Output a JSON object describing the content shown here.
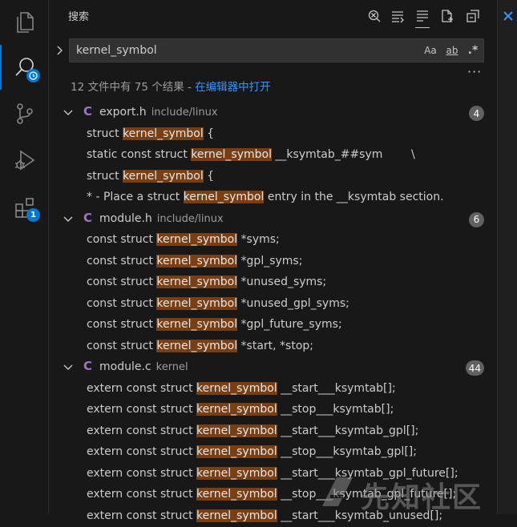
{
  "activity_bar": {
    "items": [
      {
        "name": "explorer"
      },
      {
        "name": "search",
        "active": true
      },
      {
        "name": "source-control"
      },
      {
        "name": "run-debug"
      },
      {
        "name": "extensions",
        "badge": "1"
      }
    ]
  },
  "sidebar": {
    "title": "搜索",
    "header_icons": [
      "clear-results-icon",
      "replace-all-icon",
      "collapse-view-icon",
      "new-search-editor-icon",
      "collapse-all-icon"
    ],
    "search": {
      "value": "kernel_symbol",
      "options": {
        "match_case": "Aa",
        "whole_word": "ab",
        "regex": ".*"
      }
    },
    "more": "···",
    "summary": {
      "text": "12 文件中有 75 个结果 - ",
      "link": "在编辑器中打开"
    },
    "files": [
      {
        "name": "export.h",
        "path": "include/linux",
        "count": "4",
        "matches": [
          {
            "pre": "struct ",
            "hl": "kernel_symbol",
            "post": " {"
          },
          {
            "pre": "static const struct ",
            "hl": "kernel_symbol",
            "post": " __ksymtab_##sym        \\"
          },
          {
            "pre": "struct ",
            "hl": "kernel_symbol",
            "post": " {"
          },
          {
            "pre": "* - Place a struct ",
            "hl": "kernel_symbol",
            "post": " entry in the __ksymtab section."
          }
        ]
      },
      {
        "name": "module.h",
        "path": "include/linux",
        "count": "6",
        "matches": [
          {
            "pre": "const struct ",
            "hl": "kernel_symbol",
            "post": " *syms;"
          },
          {
            "pre": "const struct ",
            "hl": "kernel_symbol",
            "post": " *gpl_syms;"
          },
          {
            "pre": "const struct ",
            "hl": "kernel_symbol",
            "post": " *unused_syms;"
          },
          {
            "pre": "const struct ",
            "hl": "kernel_symbol",
            "post": " *unused_gpl_syms;"
          },
          {
            "pre": "const struct ",
            "hl": "kernel_symbol",
            "post": " *gpl_future_syms;"
          },
          {
            "pre": "const struct ",
            "hl": "kernel_symbol",
            "post": " *start, *stop;"
          }
        ]
      },
      {
        "name": "module.c",
        "path": "kernel",
        "count": "44",
        "matches": [
          {
            "pre": "extern const struct ",
            "hl": "kernel_symbol",
            "post": " __start___ksymtab[];"
          },
          {
            "pre": "extern const struct ",
            "hl": "kernel_symbol",
            "post": " __stop___ksymtab[];"
          },
          {
            "pre": "extern const struct ",
            "hl": "kernel_symbol",
            "post": " __start___ksymtab_gpl[];"
          },
          {
            "pre": "extern const struct ",
            "hl": "kernel_symbol",
            "post": " __stop___ksymtab_gpl[];"
          },
          {
            "pre": "extern const struct ",
            "hl": "kernel_symbol",
            "post": " __start___ksymtab_gpl_future[];"
          },
          {
            "pre": "extern const struct ",
            "hl": "kernel_symbol",
            "post": " __stop___ksymtab_gpl_future[];"
          },
          {
            "pre": "extern const struct ",
            "hl": "kernel_symbol",
            "post": " __start___ksymtab_unused[];"
          }
        ]
      }
    ]
  },
  "watermark": {
    "text": "先知社区"
  },
  "colors": {
    "accent": "#0078d4",
    "highlight": "#7a3e13",
    "link": "#3794ff",
    "c_icon": "#a074c4"
  }
}
